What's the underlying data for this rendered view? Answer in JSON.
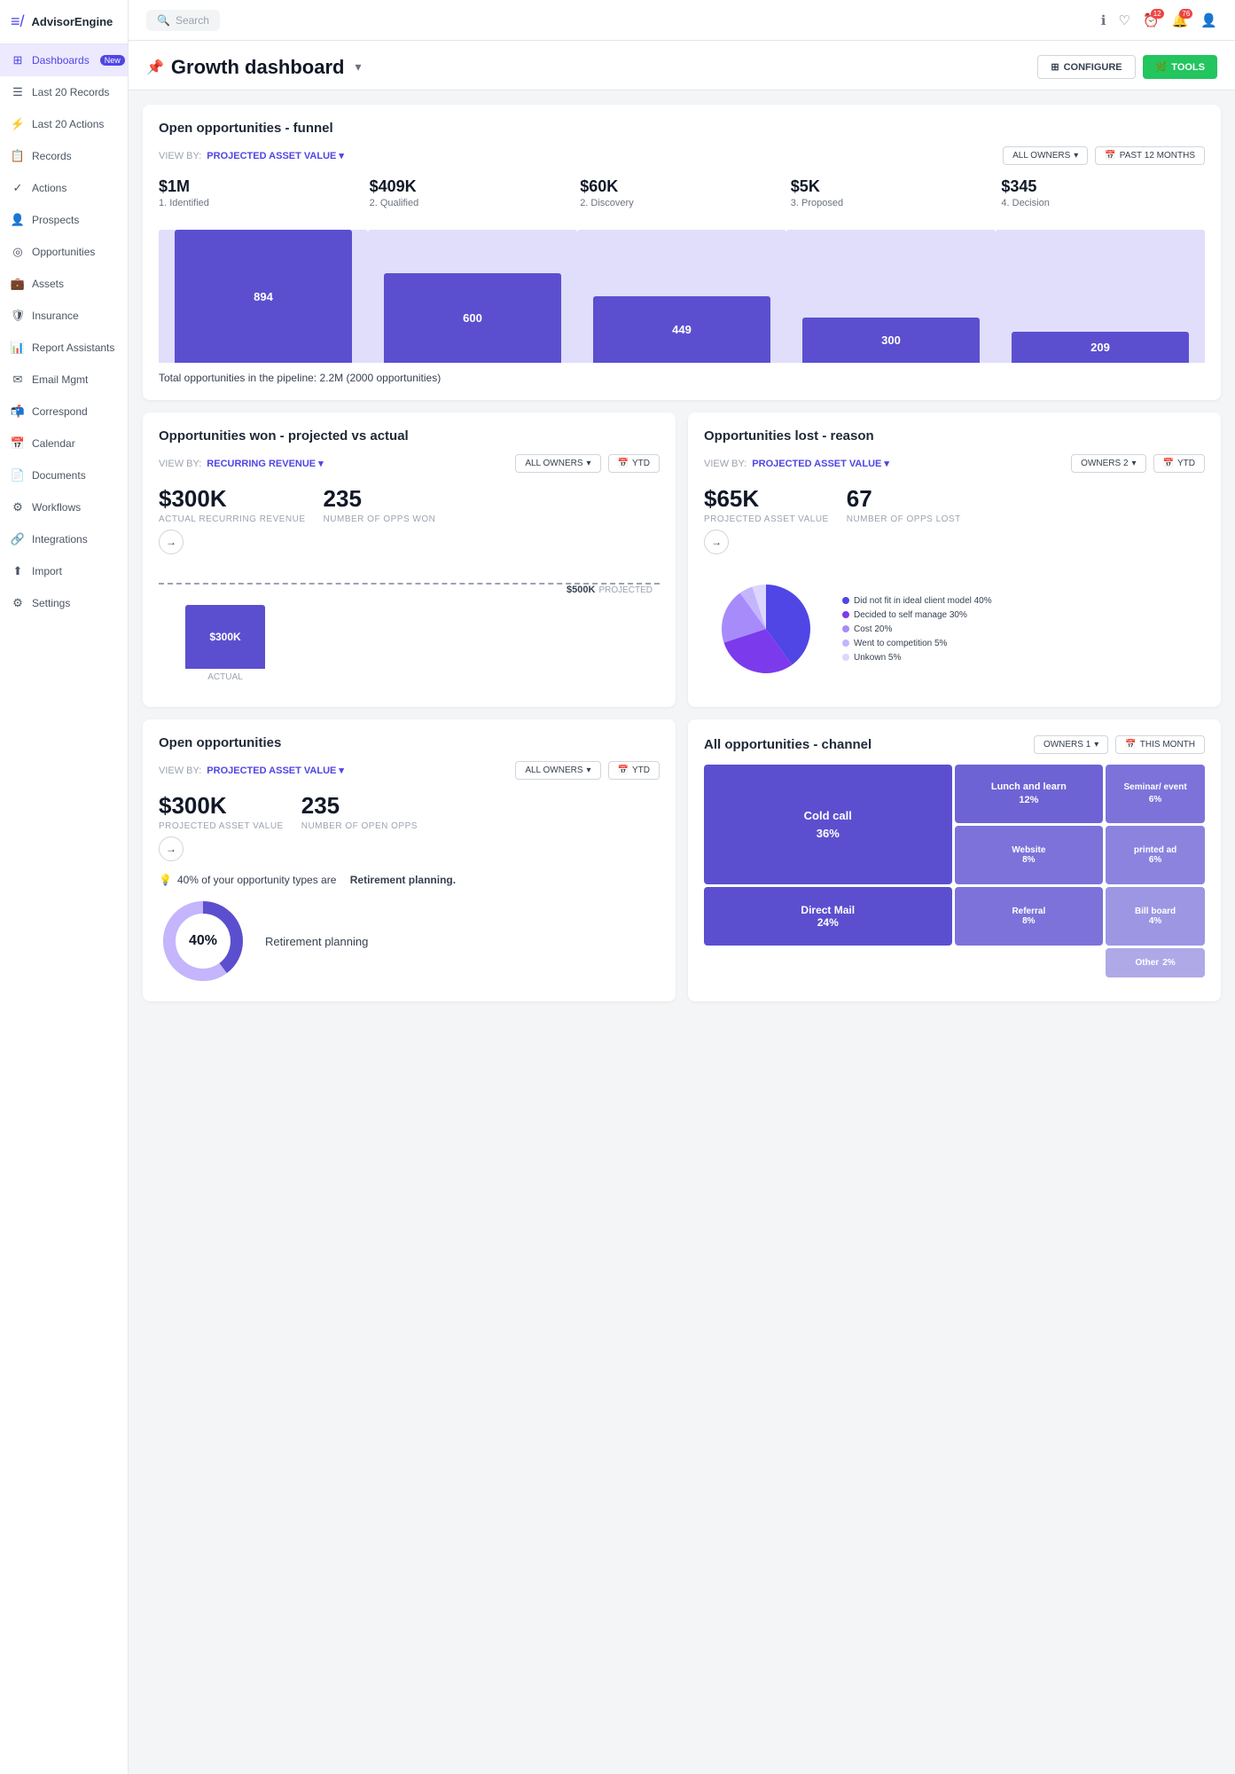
{
  "app": {
    "name": "AdvisorEngine"
  },
  "topbar": {
    "search_placeholder": "Search",
    "notification_count": "76",
    "alert_count": "12"
  },
  "sidebar": {
    "items": [
      {
        "id": "dashboards",
        "label": "Dashboards",
        "badge": "New",
        "active": true,
        "icon": "⊞"
      },
      {
        "id": "last20records",
        "label": "Last 20 Records",
        "icon": "☰"
      },
      {
        "id": "last20actions",
        "label": "Last 20 Actions",
        "icon": "⚡"
      },
      {
        "id": "records",
        "label": "Records",
        "icon": "📋"
      },
      {
        "id": "actions",
        "label": "Actions",
        "icon": "✓"
      },
      {
        "id": "prospects",
        "label": "Prospects",
        "icon": "👤"
      },
      {
        "id": "opportunities",
        "label": "Opportunities",
        "icon": "◎"
      },
      {
        "id": "assets",
        "label": "Assets",
        "icon": "💼"
      },
      {
        "id": "insurance",
        "label": "Insurance",
        "icon": "🛡"
      },
      {
        "id": "reportassistants",
        "label": "Report Assistants",
        "icon": "📊"
      },
      {
        "id": "emailmgmt",
        "label": "Email Mgmt",
        "icon": "✉"
      },
      {
        "id": "correspond",
        "label": "Correspond",
        "icon": "📬"
      },
      {
        "id": "calendar",
        "label": "Calendar",
        "icon": "📅"
      },
      {
        "id": "documents",
        "label": "Documents",
        "icon": "📄"
      },
      {
        "id": "workflows",
        "label": "Workflows",
        "icon": "⚙"
      },
      {
        "id": "integrations",
        "label": "Integrations",
        "icon": "🔗"
      },
      {
        "id": "import",
        "label": "Import",
        "icon": "⬆"
      },
      {
        "id": "settings",
        "label": "Settings",
        "icon": "⚙"
      }
    ]
  },
  "dashboard": {
    "title": "Growth dashboard",
    "btn_configure": "CONFIGURE",
    "btn_tools": "TOOLS"
  },
  "funnel": {
    "title": "Open opportunities - funnel",
    "view_by_label": "VIEW BY:",
    "view_by_value": "PROJECTED ASSET VALUE",
    "filter_owners": "ALL OWNERS",
    "filter_period": "PAST 12 MONTHS",
    "stats": [
      {
        "value": "$1M",
        "label": "1. Identified"
      },
      {
        "value": "$409K",
        "label": "2. Qualified"
      },
      {
        "value": "$60K",
        "label": "2. Discovery"
      },
      {
        "value": "$5K",
        "label": "3. Proposed"
      },
      {
        "value": "$345",
        "label": "4. Decision"
      }
    ],
    "bars": [
      {
        "count": 894,
        "height_pct": 100
      },
      {
        "count": 600,
        "height_pct": 67
      },
      {
        "count": 449,
        "height_pct": 50
      },
      {
        "count": 300,
        "height_pct": 34
      },
      {
        "count": 209,
        "height_pct": 23
      }
    ],
    "total_text": "Total opportunities in the pipeline: 2.2M (2000 opportunities)"
  },
  "opps_won": {
    "title": "Opportunities won - projected vs actual",
    "view_by_label": "VIEW BY:",
    "view_by_value": "RECURRING REVENUE",
    "filter_owners": "ALL OWNERS",
    "filter_period": "YTD",
    "actual_value": "$300K",
    "actual_label": "ACTUAL RECURRING REVENUE",
    "count": "235",
    "count_label": "NUMBER OF OPPS WON",
    "projected_value": "$500K",
    "projected_label": "PROJECTED",
    "actual_bar_value": "$300K",
    "actual_bar_label": "ACTUAL"
  },
  "opps_lost": {
    "title": "Opportunities lost - reason",
    "view_by_label": "VIEW BY:",
    "view_by_value": "PROJECTED ASSET VALUE",
    "filter_owners": "OWNERS 2",
    "filter_period": "YTD",
    "value": "$65K",
    "value_label": "PROJECTED ASSET VALUE",
    "count": "67",
    "count_label": "NUMBER OF OPPS LOST",
    "pie_segments": [
      {
        "label": "Did not fit in ideal client model",
        "pct": 40,
        "color": "#4f46e5"
      },
      {
        "label": "Decided to self manage",
        "pct": 30,
        "color": "#7c3aed"
      },
      {
        "label": "Cost",
        "pct": 20,
        "color": "#a78bfa"
      },
      {
        "label": "Went to competition",
        "pct": 5,
        "color": "#c4b5fd"
      },
      {
        "label": "Unkown",
        "pct": 5,
        "color": "#ddd6fe"
      }
    ]
  },
  "open_opps": {
    "title": "Open opportunities",
    "view_by_label": "VIEW BY:",
    "view_by_value": "PROJECTED ASSET VALUE",
    "filter_owners": "ALL OWNERS",
    "filter_period": "YTD",
    "value": "$300K",
    "value_label": "PROJECTED ASSET VALUE",
    "count": "235",
    "count_label": "NUMBER OF OPEN OPPS",
    "insight": "40% of your opportunity types are",
    "insight_bold": "Retirement planning.",
    "donut_pct": "40%",
    "donut_label": "Retirement planning"
  },
  "all_opps_channel": {
    "title": "All opportunities - channel",
    "filter_owners": "OWNERS 1",
    "filter_period": "THIS MONTH",
    "cells": [
      {
        "label": "Cold call",
        "pct": "36%",
        "color": "#5b4fcf",
        "col": 1,
        "row": 1,
        "span_col": 1,
        "span_row": 2
      },
      {
        "label": "Lunch and learn",
        "pct": "12%",
        "color": "#6d63d4",
        "col": 2,
        "row": 1
      },
      {
        "label": "Seminar/ event",
        "pct": "6%",
        "color": "#7c72d9",
        "col": 3,
        "row": 1
      },
      {
        "label": "Direct Mail",
        "pct": "24%",
        "color": "#5b4fcf",
        "col": 1,
        "row": 2
      },
      {
        "label": "Website",
        "pct": "8%",
        "color": "#7c72d9",
        "col": 2,
        "row": 2
      },
      {
        "label": "printed ad",
        "pct": "6%",
        "color": "#8c83de",
        "col": 3,
        "row": 2
      },
      {
        "label": "Referral",
        "pct": "8%",
        "color": "#7c72d9",
        "col": 2,
        "row": 3
      },
      {
        "label": "Bill board",
        "pct": "4%",
        "color": "#9d96e3",
        "col": 3,
        "row": 3
      },
      {
        "label": "Other",
        "pct": "2%",
        "color": "#afa9e8",
        "col": 3,
        "row": 4
      }
    ]
  }
}
